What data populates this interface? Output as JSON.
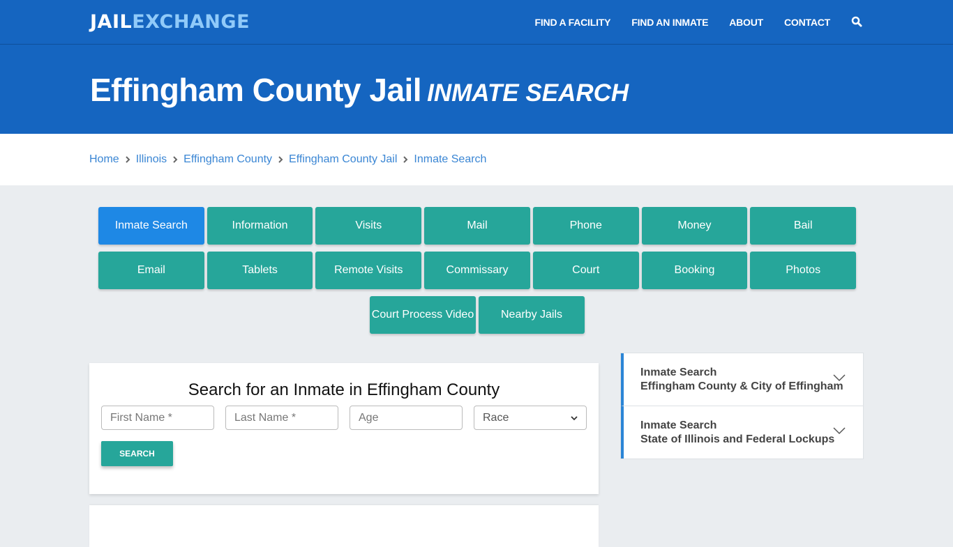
{
  "nav": {
    "logo_part1": "JAIL",
    "logo_part2": "EXCHANGE",
    "links": [
      "FIND A FACILITY",
      "FIND AN INMATE",
      "ABOUT",
      "CONTACT"
    ],
    "search_icon": "search-icon"
  },
  "hero": {
    "title": "Effingham County Jail",
    "subtitle": "INMATE SEARCH"
  },
  "breadcrumb": [
    "Home",
    "Illinois",
    "Effingham County",
    "Effingham County Jail",
    "Inmate Search"
  ],
  "tabs": {
    "row1": [
      "Inmate Search",
      "Information",
      "Visits",
      "Mail",
      "Phone",
      "Money",
      "Bail"
    ],
    "row2": [
      "Email",
      "Tablets",
      "Remote Visits",
      "Commissary",
      "Court",
      "Booking",
      "Photos"
    ],
    "row3": [
      "Court Process Video",
      "Nearby Jails"
    ],
    "active": "Inmate Search"
  },
  "search_form": {
    "heading": "Search for an Inmate in Effingham County",
    "first_name_placeholder": "First Name *",
    "last_name_placeholder": "Last Name *",
    "age_placeholder": "Age",
    "race_selected": "Race",
    "submit_label": "SEARCH"
  },
  "accordion": [
    {
      "line1": "Inmate Search",
      "line2": "Effingham County & City of Effingham"
    },
    {
      "line1": "Inmate Search",
      "line2": "State of Illinois and Federal Lockups"
    }
  ],
  "colors": {
    "brand_blue": "#1565c0",
    "logo_light": "#90caf9",
    "teal": "#26a69a",
    "active_blue": "#1e88e5",
    "link_blue": "#3a86d4"
  }
}
